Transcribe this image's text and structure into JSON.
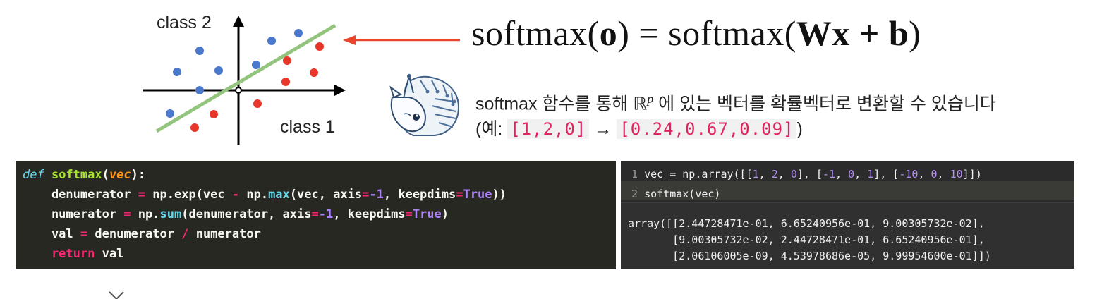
{
  "diagram": {
    "class2_label": "class 2",
    "class1_label": "class 1",
    "colors": {
      "class2": "#4a78cc",
      "class1": "#e8372a",
      "boundary": "#93c47d",
      "arrow": "#e8452a"
    }
  },
  "formula": {
    "lhs_fn": "softmax",
    "lhs_arg": "o",
    "equals": "=",
    "rhs_fn": "softmax",
    "rhs_W": "W",
    "rhs_x": "x",
    "rhs_plus": "+",
    "rhs_b": "b"
  },
  "description": {
    "line1_a": "softmax 함수를 통해",
    "line1_space": "ℝ",
    "line1_sup": "p",
    "line1_b": "에 있는 벡터를 확률벡터로 변환할 수 있습니다",
    "line2_open": "(예:",
    "example_in": "[1,2,0]",
    "arrow": "→",
    "example_out": "[0.24,0.67,0.09]",
    "line2_close": ")"
  },
  "code_left": {
    "def": "def",
    "fname": "softmax",
    "param": "vec",
    "l2a": "    denumerator",
    "l2b": " np.exp(vec ",
    "l2c": " np.",
    "l2d": "max",
    "l2e": "(vec, axis",
    "l2f": "-1",
    "l2g": ", keepdims",
    "l2h": "True",
    "l2i": "))",
    "l3a": "    numerator",
    "l3b": " np.",
    "l3c": "sum",
    "l3d": "(denumerator, axis",
    "l3e": "-1",
    "l3f": ", keepdims",
    "l3g": "True",
    "l3h": ")",
    "l4a": "    val",
    "l4b": " denumerator ",
    "l4c": " numerator",
    "l5a": "    return",
    "l5b": " val"
  },
  "code_right": {
    "ln1": " 1",
    "ln2": " 2",
    "src1a": " vec = np.array([[",
    "src1b": "1",
    "src1c": ", ",
    "src1d": "2",
    "src1e": ", ",
    "src1f": "0",
    "src1g": "], [",
    "src1h": "-1",
    "src1i": ", ",
    "src1j": "0",
    "src1k": ", ",
    "src1l": "1",
    "src1m": "], [",
    "src1n": "-10",
    "src1o": ", ",
    "src1p": "0",
    "src1q": ", ",
    "src1r": "10",
    "src1s": "]])",
    "src2": " softmax(vec)",
    "out1": "array([[2.44728471e-01, 6.65240956e-01, 9.00305732e-02],",
    "out2": "       [9.00305732e-02, 2.44728471e-01, 6.65240956e-01],",
    "out3": "       [2.06106005e-09, 4.53978686e-05, 9.99954600e-01]])"
  }
}
